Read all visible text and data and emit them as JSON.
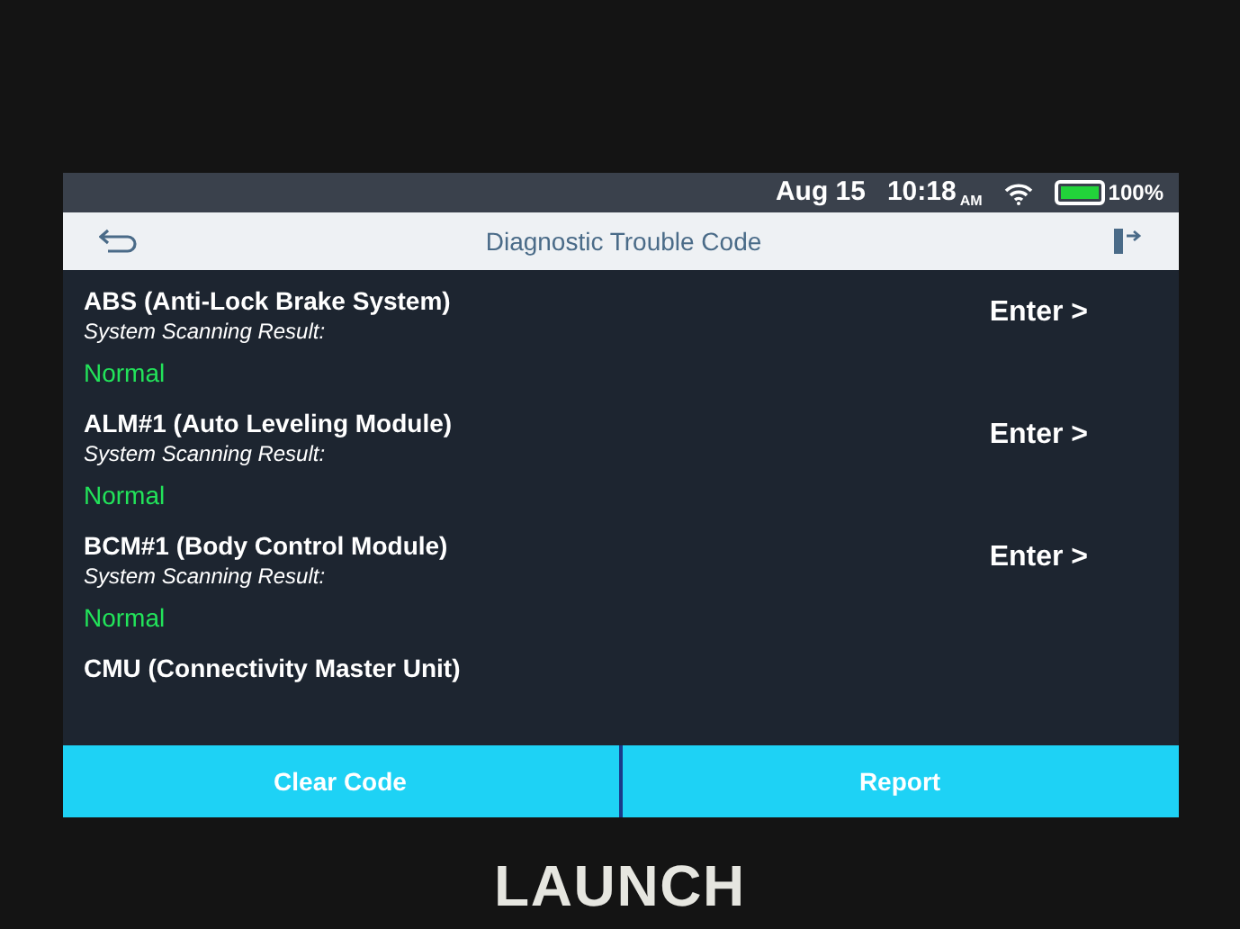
{
  "status_bar": {
    "date": "Aug 15",
    "time": "10:18",
    "ampm": "AM",
    "battery_text": "100%"
  },
  "header": {
    "title": "Diagnostic Trouble Code"
  },
  "systems": [
    {
      "name": "ABS (Anti-Lock Brake System)",
      "result_label": "System Scanning Result:",
      "result": "Normal",
      "action": "Enter >"
    },
    {
      "name": "ALM#1 (Auto Leveling Module)",
      "result_label": "System Scanning Result:",
      "result": "Normal",
      "action": "Enter >"
    },
    {
      "name": "BCM#1 (Body Control Module)",
      "result_label": "System Scanning Result:",
      "result": "Normal",
      "action": "Enter >"
    },
    {
      "name": "CMU (Connectivity Master Unit)"
    }
  ],
  "buttons": [
    "Clear Code",
    "Report"
  ],
  "brand": "LAUNCH"
}
